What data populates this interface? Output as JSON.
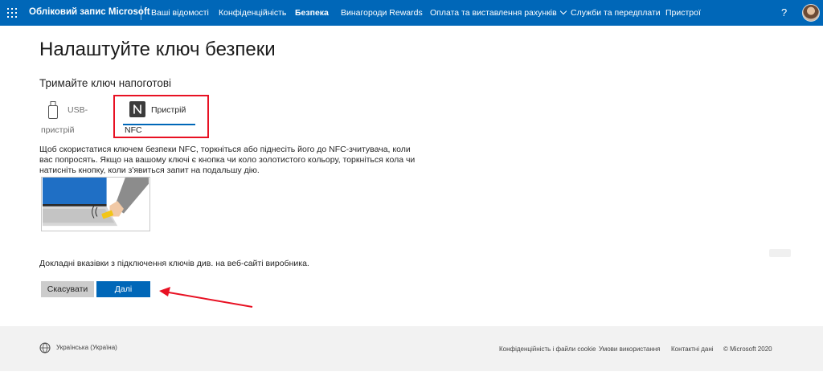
{
  "header": {
    "brand": "Обліковий запис Microsoft",
    "nav": [
      {
        "label": "Ваші відомості"
      },
      {
        "label": "Конфіденційність"
      },
      {
        "label": "Безпека"
      },
      {
        "label": "Винагороди Rewards"
      },
      {
        "label": "Оплата та виставлення рахунків"
      },
      {
        "label": "Служби та передплати"
      },
      {
        "label": "Пристрої"
      }
    ],
    "help": "?",
    "active_nav": "Безпека"
  },
  "main": {
    "title": "Налаштуйте ключ безпеки",
    "subtitle": "Тримайте ключ напоготові",
    "options": {
      "usb": {
        "line1": "USB-",
        "line2": "пристрій"
      },
      "nfc": {
        "line1": "Пристрій",
        "line2": "NFC"
      }
    },
    "instruction": "Щоб скористатися ключем безпеки NFC, торкніться або піднесіть його до NFC-зчитувача, коли вас попросять. Якщо на вашому ключі є кнопка чи коло золотистого кольору, торкніться кола чи натисніть кнопку, коли з'явиться запит на подальшу дію.",
    "note": "Докладні вказівки з підключення ключів див. на веб-сайті виробника.",
    "buttons": {
      "cancel": "Скасувати",
      "next": "Далі"
    }
  },
  "footer": {
    "language": "Українська (Україна)",
    "links": [
      {
        "label": "Конфіденційність і файли cookie"
      },
      {
        "label": "Умови використання"
      },
      {
        "label": "Контактні дані"
      }
    ],
    "copyright": "© Microsoft 2020"
  },
  "colors": {
    "brand_blue": "#0067b8",
    "highlight_red": "#e81123",
    "footer_bg": "#f2f2f2"
  },
  "icons": [
    "app-launcher-icon",
    "chevron-down-icon",
    "help-icon",
    "usb-key-icon",
    "nfc-icon",
    "globe-icon"
  ]
}
